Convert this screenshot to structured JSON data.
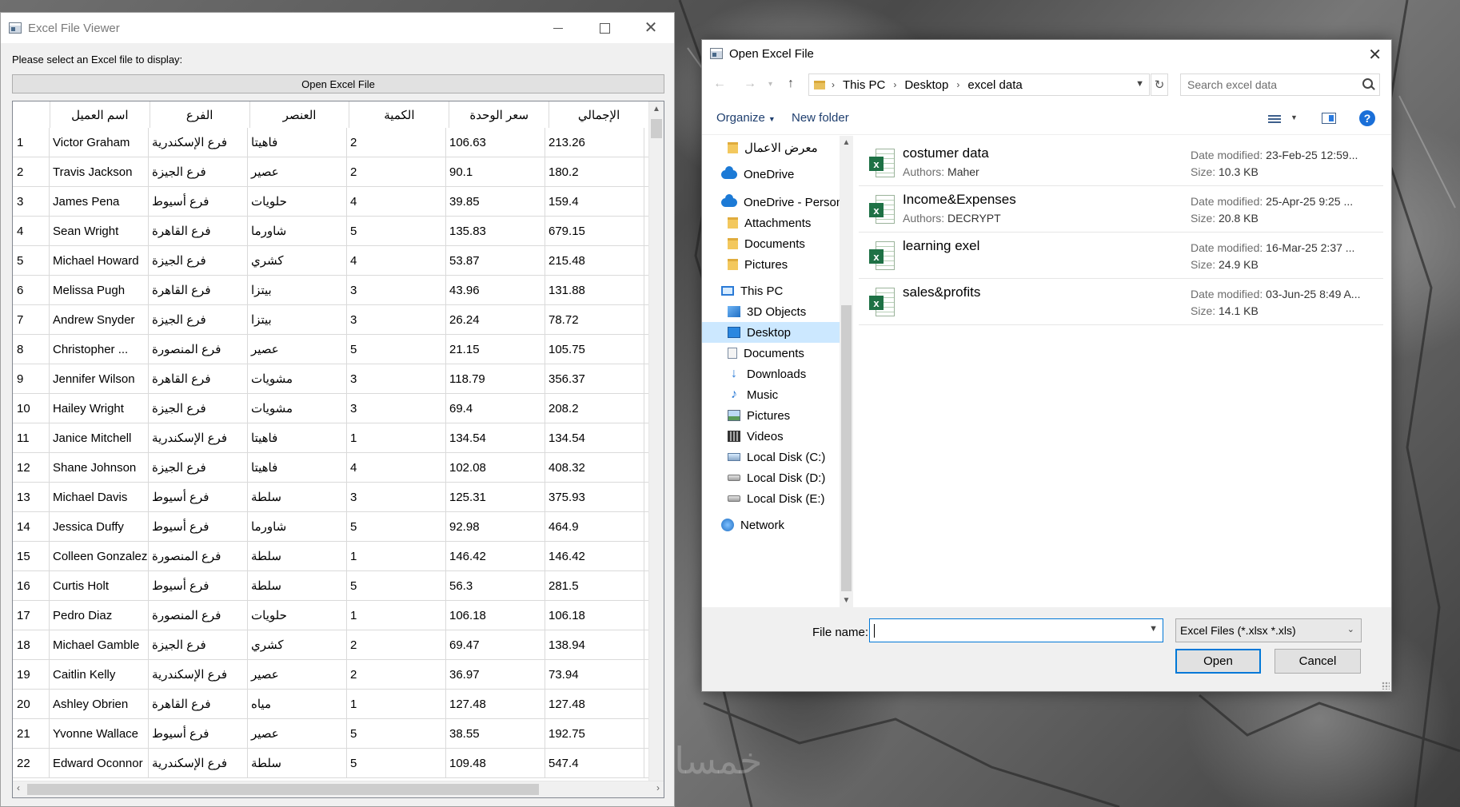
{
  "viewer": {
    "title": "Excel File Viewer",
    "prompt": "Please select an Excel file to display:",
    "open_button": "Open Excel File",
    "columns": [
      "اسم العميل",
      "الفرع",
      "العنصر",
      "الكمية",
      "سعر الوحدة",
      "الإجمالي"
    ],
    "rows": [
      {
        "n": "1",
        "name": "Victor Graham",
        "branch": "فرع الإسكندرية",
        "item": "فاهيتا",
        "qty": "2",
        "price": "106.63",
        "total": "213.26"
      },
      {
        "n": "2",
        "name": "Travis Jackson",
        "branch": "فرع الجيزة",
        "item": "عصير",
        "qty": "2",
        "price": "90.1",
        "total": "180.2"
      },
      {
        "n": "3",
        "name": "James Pena",
        "branch": "فرع أسيوط",
        "item": "حلويات",
        "qty": "4",
        "price": "39.85",
        "total": "159.4"
      },
      {
        "n": "4",
        "name": "Sean Wright",
        "branch": "فرع القاهرة",
        "item": "شاورما",
        "qty": "5",
        "price": "135.83",
        "total": "679.15"
      },
      {
        "n": "5",
        "name": "Michael Howard",
        "branch": "فرع الجيزة",
        "item": "كشري",
        "qty": "4",
        "price": "53.87",
        "total": "215.48"
      },
      {
        "n": "6",
        "name": "Melissa Pugh",
        "branch": "فرع القاهرة",
        "item": "بيتزا",
        "qty": "3",
        "price": "43.96",
        "total": "131.88"
      },
      {
        "n": "7",
        "name": "Andrew Snyder",
        "branch": "فرع الجيزة",
        "item": "بيتزا",
        "qty": "3",
        "price": "26.24",
        "total": "78.72"
      },
      {
        "n": "8",
        "name": "Christopher ...",
        "branch": "فرع المنصورة",
        "item": "عصير",
        "qty": "5",
        "price": "21.15",
        "total": "105.75"
      },
      {
        "n": "9",
        "name": "Jennifer Wilson",
        "branch": "فرع القاهرة",
        "item": "مشويات",
        "qty": "3",
        "price": "118.79",
        "total": "356.37"
      },
      {
        "n": "10",
        "name": "Hailey Wright",
        "branch": "فرع الجيزة",
        "item": "مشويات",
        "qty": "3",
        "price": "69.4",
        "total": "208.2"
      },
      {
        "n": "11",
        "name": "Janice Mitchell",
        "branch": "فرع الإسكندرية",
        "item": "فاهيتا",
        "qty": "1",
        "price": "134.54",
        "total": "134.54"
      },
      {
        "n": "12",
        "name": "Shane Johnson",
        "branch": "فرع الجيزة",
        "item": "فاهيتا",
        "qty": "4",
        "price": "102.08",
        "total": "408.32"
      },
      {
        "n": "13",
        "name": "Michael Davis",
        "branch": "فرع أسيوط",
        "item": "سلطة",
        "qty": "3",
        "price": "125.31",
        "total": "375.93"
      },
      {
        "n": "14",
        "name": "Jessica Duffy",
        "branch": "فرع أسيوط",
        "item": "شاورما",
        "qty": "5",
        "price": "92.98",
        "total": "464.9"
      },
      {
        "n": "15",
        "name": "Colleen Gonzalez",
        "branch": "فرع المنصورة",
        "item": "سلطة",
        "qty": "1",
        "price": "146.42",
        "total": "146.42"
      },
      {
        "n": "16",
        "name": "Curtis Holt",
        "branch": "فرع أسيوط",
        "item": "سلطة",
        "qty": "5",
        "price": "56.3",
        "total": "281.5"
      },
      {
        "n": "17",
        "name": "Pedro Diaz",
        "branch": "فرع المنصورة",
        "item": "حلويات",
        "qty": "1",
        "price": "106.18",
        "total": "106.18"
      },
      {
        "n": "18",
        "name": "Michael Gamble",
        "branch": "فرع الجيزة",
        "item": "كشري",
        "qty": "2",
        "price": "69.47",
        "total": "138.94"
      },
      {
        "n": "19",
        "name": "Caitlin Kelly",
        "branch": "فرع الإسكندرية",
        "item": "عصير",
        "qty": "2",
        "price": "36.97",
        "total": "73.94"
      },
      {
        "n": "20",
        "name": "Ashley Obrien",
        "branch": "فرع القاهرة",
        "item": "مياه",
        "qty": "1",
        "price": "127.48",
        "total": "127.48"
      },
      {
        "n": "21",
        "name": "Yvonne Wallace",
        "branch": "فرع أسيوط",
        "item": "عصير",
        "qty": "5",
        "price": "38.55",
        "total": "192.75"
      },
      {
        "n": "22",
        "name": "Edward Oconnor",
        "branch": "فرع الإسكندرية",
        "item": "سلطة",
        "qty": "5",
        "price": "109.48",
        "total": "547.4"
      }
    ]
  },
  "dialog": {
    "title": "Open Excel File",
    "breadcrumb": [
      "This PC",
      "Desktop",
      "excel data"
    ],
    "search_placeholder": "Search excel data",
    "organize": "Organize",
    "new_folder": "New folder",
    "nav_items": [
      {
        "label": "معرض الاعمال",
        "icon": "folder-icon"
      },
      {
        "label": "OneDrive",
        "icon": "onedrive-icon"
      },
      {
        "label": "OneDrive - Person",
        "icon": "onedrive-icon"
      },
      {
        "label": "Attachments",
        "icon": "folder-icon"
      },
      {
        "label": "Documents",
        "icon": "folder-icon"
      },
      {
        "label": "Pictures",
        "icon": "folder-icon"
      },
      {
        "label": "This PC",
        "icon": "computer-icon"
      },
      {
        "label": "3D Objects",
        "icon": "3d-objects-icon"
      },
      {
        "label": "Desktop",
        "icon": "desktop-icon"
      },
      {
        "label": "Documents",
        "icon": "documents-icon"
      },
      {
        "label": "Downloads",
        "icon": "downloads-icon"
      },
      {
        "label": "Music",
        "icon": "music-icon"
      },
      {
        "label": "Pictures",
        "icon": "pictures-icon"
      },
      {
        "label": "Videos",
        "icon": "videos-icon"
      },
      {
        "label": "Local Disk (C:)",
        "icon": "disk-icon"
      },
      {
        "label": "Local Disk (D:)",
        "icon": "disk-icon"
      },
      {
        "label": "Local Disk (E:)",
        "icon": "disk-icon"
      },
      {
        "label": "Network",
        "icon": "network-icon"
      }
    ],
    "selected_nav": "Desktop",
    "files": [
      {
        "name": "costumer data",
        "authors_label": "Authors:",
        "author": "Maher",
        "date_label": "Date modified:",
        "date": "23-Feb-25 12:59...",
        "size_label": "Size:",
        "size": "10.3 KB"
      },
      {
        "name": "Income&Expenses",
        "authors_label": "Authors:",
        "author": "DECRYPT",
        "date_label": "Date modified:",
        "date": "25-Apr-25 9:25 ...",
        "size_label": "Size:",
        "size": "20.8 KB"
      },
      {
        "name": "learning exel",
        "authors_label": "",
        "author": "",
        "date_label": "Date modified:",
        "date": "16-Mar-25 2:37 ...",
        "size_label": "Size:",
        "size": "24.9 KB"
      },
      {
        "name": "sales&profits",
        "authors_label": "",
        "author": "",
        "date_label": "Date modified:",
        "date": "03-Jun-25 8:49 A...",
        "size_label": "Size:",
        "size": "14.1 KB"
      }
    ],
    "file_name_label": "File name:",
    "file_name_value": "",
    "filter": "Excel Files (*.xlsx *.xls)",
    "open_button": "Open",
    "cancel_button": "Cancel"
  },
  "watermark": "خمسات"
}
